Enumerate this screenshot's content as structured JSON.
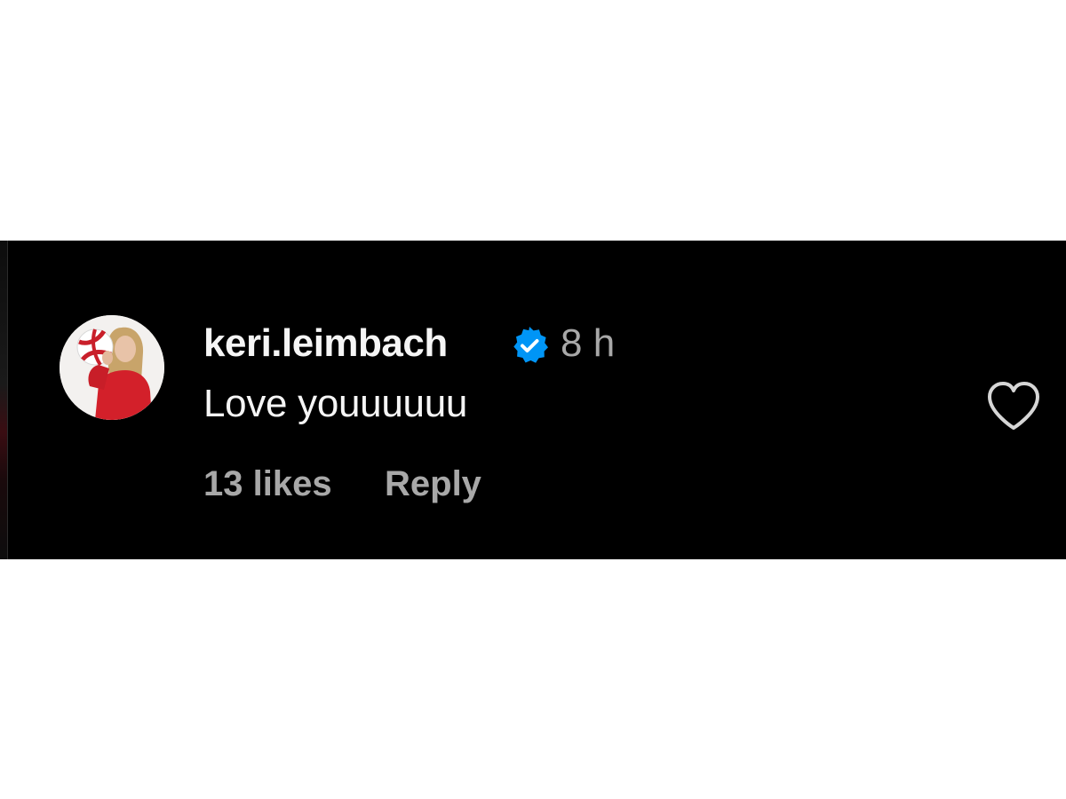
{
  "comment": {
    "username": "keri.leimbach",
    "verified": true,
    "timestamp": "8 h",
    "text": "Love youuuuuu",
    "likes_label": "13 likes",
    "reply_label": "Reply"
  },
  "icons": {
    "verified": "verified-badge-icon",
    "like": "heart-outline-icon"
  },
  "colors": {
    "panel_background": "#000000",
    "primary_text": "#f5f5f5",
    "secondary_text": "#a8a8a8",
    "verified_blue": "#0095f6"
  }
}
